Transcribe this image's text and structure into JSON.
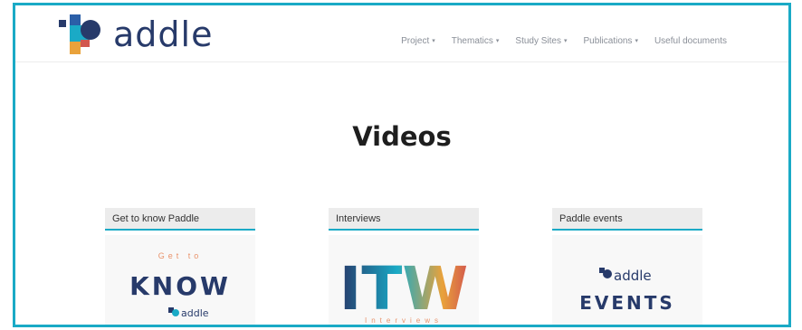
{
  "brand": {
    "name": "addle",
    "colors": {
      "navy": "#273a6a",
      "teal": "#1aaac6",
      "frame": "#1aaac6"
    }
  },
  "nav": {
    "items": [
      {
        "label": "Project",
        "caret": "▾"
      },
      {
        "label": "Thematics",
        "caret": "▾"
      },
      {
        "label": "Study Sites",
        "caret": "▾"
      },
      {
        "label": "Publications",
        "caret": "▾"
      },
      {
        "label": "Useful documents",
        "caret": ""
      }
    ]
  },
  "main": {
    "title": "Videos",
    "cards": [
      {
        "header": "Get to know Paddle",
        "thumb": {
          "line1": "Get to",
          "line2": "KNOW",
          "brand": "addle"
        }
      },
      {
        "header": "Interviews",
        "thumb": {
          "line1": "ITW",
          "line2": "Interviews"
        }
      },
      {
        "header": "Paddle events",
        "thumb": {
          "brand": "addle",
          "line2": "EVENTS"
        }
      }
    ]
  }
}
